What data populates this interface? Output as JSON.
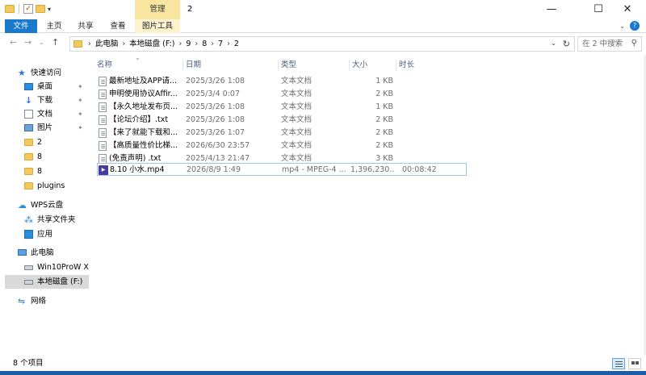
{
  "titlebar": {
    "context_tab": "管理",
    "title": "2",
    "controls": {
      "minimize": "—",
      "maximize": "☐",
      "close": "✕"
    }
  },
  "ribbon": {
    "tabs": [
      "文件",
      "主页",
      "共享",
      "查看",
      "图片工具"
    ],
    "help": "?"
  },
  "nav": {
    "back": "←",
    "forward": "→",
    "up_menu": "⌄",
    "up": "↑"
  },
  "address": {
    "crumbs": [
      "此电脑",
      "本地磁盘 (F:)",
      "9",
      "8",
      "7",
      "2"
    ]
  },
  "search": {
    "placeholder": "在 2 中搜索",
    "icon": "search-icon"
  },
  "sidebar": {
    "items": [
      {
        "label": "快速访问",
        "icon": "star-icon"
      },
      {
        "label": "桌面",
        "icon": "desktop-icon",
        "pinned": true
      },
      {
        "label": "下载",
        "icon": "download-icon",
        "pinned": true
      },
      {
        "label": "文档",
        "icon": "document-icon",
        "pinned": true
      },
      {
        "label": "图片",
        "icon": "picture-icon",
        "pinned": true
      },
      {
        "label": "2",
        "icon": "folder-icon"
      },
      {
        "label": "8",
        "icon": "folder-icon"
      },
      {
        "label": "8",
        "icon": "folder-icon"
      },
      {
        "label": "plugins",
        "icon": "folder-icon"
      },
      {
        "label": "WPS云盘",
        "icon": "cloud-icon"
      },
      {
        "label": "共享文件夹",
        "icon": "share-icon"
      },
      {
        "label": "应用",
        "icon": "apps-icon"
      },
      {
        "label": "此电脑",
        "icon": "computer-icon"
      },
      {
        "label": "Win10ProW X",
        "icon": "drive-icon"
      },
      {
        "label": "本地磁盘 (F:)",
        "icon": "drive-icon",
        "selected": true
      },
      {
        "label": "网络",
        "icon": "network-icon"
      }
    ]
  },
  "columns": {
    "name": "名称",
    "date": "日期",
    "type": "类型",
    "size": "大小",
    "duration": "时长"
  },
  "files": [
    {
      "name": "最新地址及APP请...",
      "date": "2025/3/26 1:08",
      "type": "文本文档",
      "size": "1 KB",
      "duration": "",
      "kind": "text"
    },
    {
      "name": "申明使用协议Affir...",
      "date": "2025/3/4 0:07",
      "type": "文本文档",
      "size": "2 KB",
      "duration": "",
      "kind": "text"
    },
    {
      "name": "【永久地址发布页...",
      "date": "2025/3/26 1:08",
      "type": "文本文档",
      "size": "1 KB",
      "duration": "",
      "kind": "text"
    },
    {
      "name": "【论坛介绍】.txt",
      "date": "2025/3/26 1:08",
      "type": "文本文档",
      "size": "2 KB",
      "duration": "",
      "kind": "text"
    },
    {
      "name": "【来了就能下载和...",
      "date": "2025/3/26 1:07",
      "type": "文本文档",
      "size": "2 KB",
      "duration": "",
      "kind": "text"
    },
    {
      "name": "【高质量性价比梯...",
      "date": "2026/6/30 23:57",
      "type": "文本文档",
      "size": "2 KB",
      "duration": "",
      "kind": "text"
    },
    {
      "name": "(免责声明) .txt",
      "date": "2025/4/13 21:47",
      "type": "文本文档",
      "size": "3 KB",
      "duration": "",
      "kind": "text"
    },
    {
      "name": "8.10 小水.mp4",
      "date": "2026/8/9 1:49",
      "type": "mp4 - MPEG-4 ...",
      "size": "1,396,230...",
      "duration": "00:08:42",
      "kind": "video",
      "selected": true
    }
  ],
  "status": {
    "count": "8 个项目"
  }
}
